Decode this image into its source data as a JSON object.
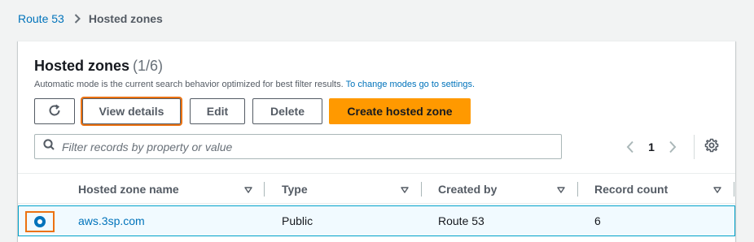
{
  "breadcrumb": {
    "root": "Route 53",
    "current": "Hosted zones"
  },
  "panel": {
    "title": "Hosted zones",
    "count": "(1/6)",
    "subtitle": "Automatic mode is the current search behavior optimized for best filter results.",
    "subtitle_link": "To change modes go to settings."
  },
  "toolbar": {
    "view_details": "View details",
    "edit": "Edit",
    "delete": "Delete",
    "create": "Create hosted zone"
  },
  "filter": {
    "placeholder": "Filter records by property or value",
    "value": ""
  },
  "pagination": {
    "current_page": "1"
  },
  "table": {
    "columns": [
      "Hosted zone name",
      "Type",
      "Created by",
      "Record count"
    ],
    "rows": [
      {
        "selected": true,
        "name": "aws.3sp.com",
        "type": "Public",
        "created_by": "Route 53",
        "record_count": "6"
      }
    ]
  },
  "icons": {
    "refresh": "refresh-icon",
    "search": "search-icon",
    "settings": "gear-icon",
    "prev": "chevron-left-icon",
    "next": "chevron-right-icon",
    "sort": "caret-down-icon",
    "breadcrumb_sep": "chevron-right-icon"
  },
  "colors": {
    "primary_button": "#ff9900",
    "link": "#0073bb",
    "focus_outline": "#ec7211",
    "selected_row_bg": "#f1faff",
    "selected_row_border": "#00a1c9"
  }
}
